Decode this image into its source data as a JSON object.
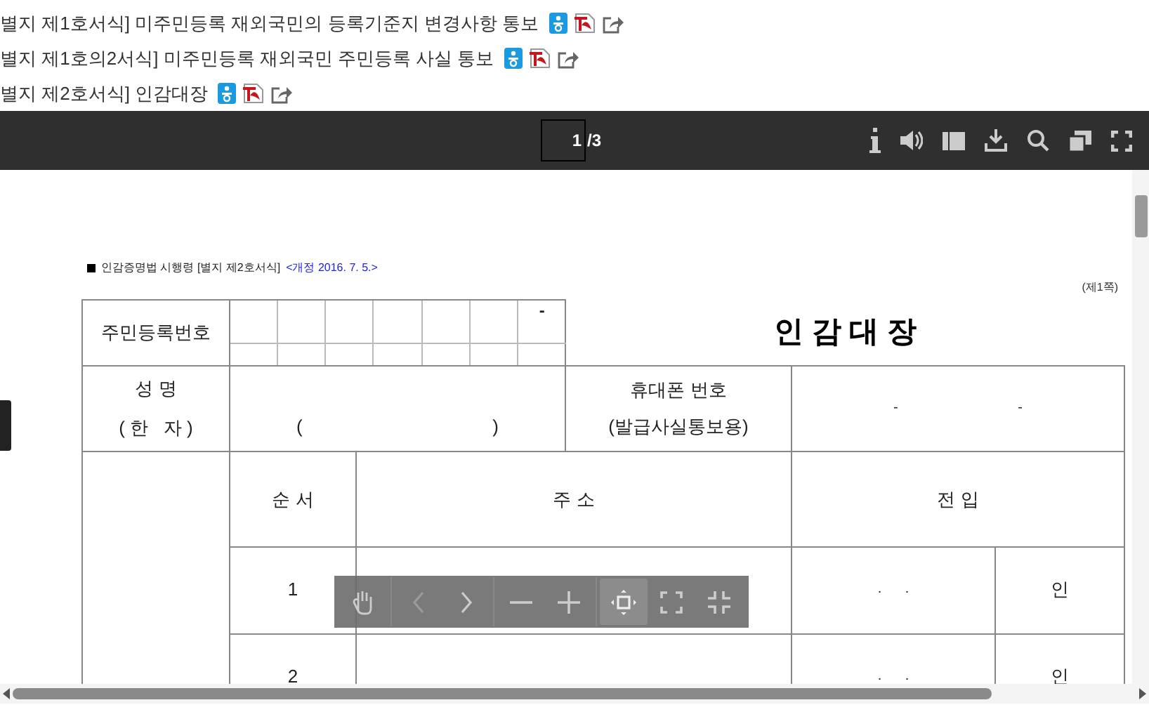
{
  "attachments": [
    {
      "title": "별지 제1호서식] 미주민등록 재외국민의 등록기준지 변경사항 통보"
    },
    {
      "title": "별지 제1호의2서식] 미주민등록 재외국민 주민등록 사실 통보"
    },
    {
      "title": "별지 제2호서식] 인감대장"
    }
  ],
  "viewer": {
    "page_input": "1",
    "page_total": "/3"
  },
  "document": {
    "header_text": "인감증명법 시행령 [별지 제2호서식]",
    "revision": "<개정 2016. 7. 5.>",
    "page_side": "(제1쪽)",
    "title": "인 감 대 장",
    "resident_number_label": "주민등록번호",
    "resident_number_dash": "-",
    "name_label": "성 명",
    "hanja_label": "( 한   자 )",
    "name_parens": [
      "(",
      ")"
    ],
    "phone_label": "휴대폰 번호",
    "phone_note": "(발급사실통보용)",
    "phone_dashes": [
      "-",
      "-"
    ],
    "columns": [
      "순 서",
      "주 소",
      "전 입"
    ],
    "rows": [
      {
        "number": "1",
        "date_dots": ".      .",
        "seal": "인"
      },
      {
        "number": "2",
        "date_dots": ".      .",
        "seal": "인"
      }
    ]
  },
  "zoom_toolbar": {
    "buttons": [
      {
        "kind": "hand",
        "selected": false,
        "disabled": false
      },
      {
        "kind": "prev",
        "selected": false,
        "disabled": true
      },
      {
        "kind": "next",
        "selected": false,
        "disabled": false
      },
      {
        "kind": "zoom-out",
        "selected": false,
        "disabled": false
      },
      {
        "kind": "zoom-in",
        "selected": false,
        "disabled": false
      },
      {
        "kind": "fit",
        "selected": true,
        "disabled": false
      },
      {
        "kind": "fullscreen",
        "selected": false,
        "disabled": false
      },
      {
        "kind": "exit-fullscreen",
        "selected": false,
        "disabled": false
      }
    ]
  }
}
